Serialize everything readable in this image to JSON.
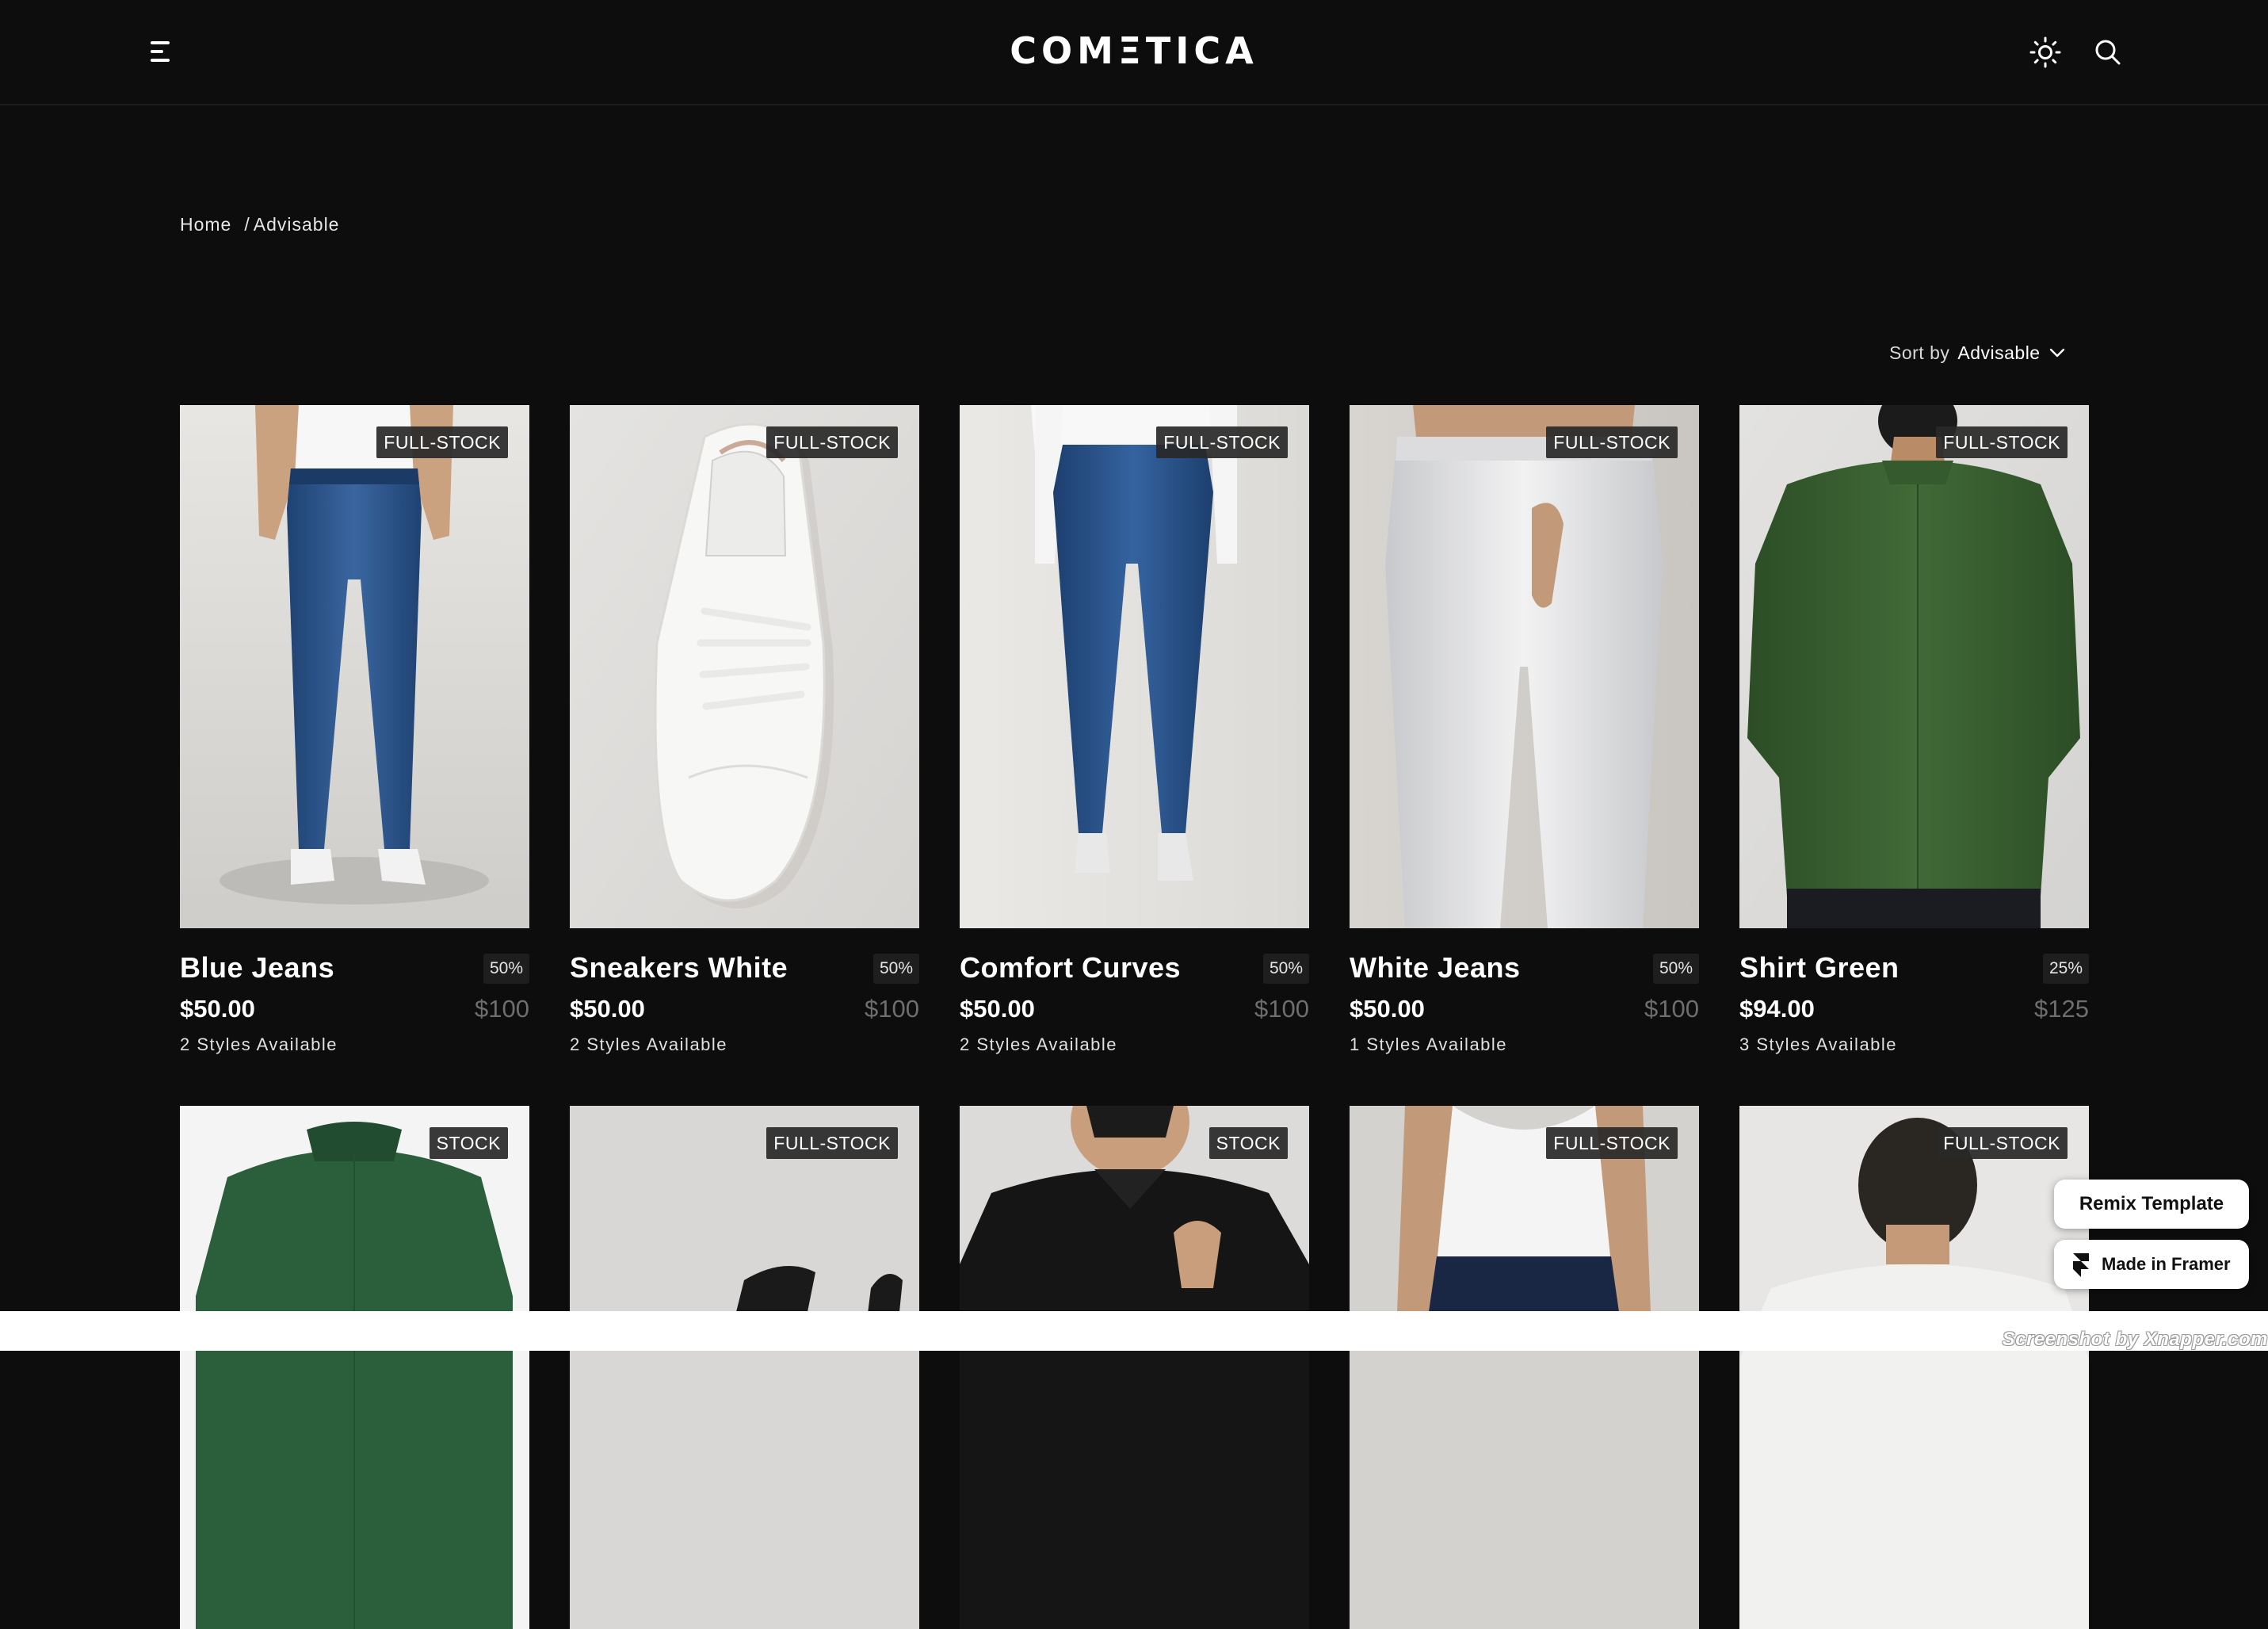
{
  "header": {
    "logo": "COMΞTICA",
    "menu_icon": "hamburger-menu-icon",
    "theme_icon": "sun-icon",
    "search_icon": "search-icon"
  },
  "breadcrumb": {
    "home": "Home",
    "separator": "/",
    "current": "Advisable"
  },
  "sort": {
    "label": "Sort by",
    "value": "Advisable",
    "icon": "chevron-down-icon"
  },
  "products": [
    {
      "name": "Blue Jeans",
      "badge": "FULL-STOCK",
      "discount": "50%",
      "price": "$50.00",
      "old_price": "$100",
      "styles": "2 Styles Available"
    },
    {
      "name": "Sneakers White",
      "badge": "FULL-STOCK",
      "discount": "50%",
      "price": "$50.00",
      "old_price": "$100",
      "styles": "2 Styles Available"
    },
    {
      "name": "Comfort Curves",
      "badge": "FULL-STOCK",
      "discount": "50%",
      "price": "$50.00",
      "old_price": "$100",
      "styles": "2 Styles Available"
    },
    {
      "name": "White Jeans",
      "badge": "FULL-STOCK",
      "discount": "50%",
      "price": "$50.00",
      "old_price": "$100",
      "styles": "1 Styles Available"
    },
    {
      "name": "Shirt Green",
      "badge": "FULL-STOCK",
      "discount": "25%",
      "price": "$94.00",
      "old_price": "$125",
      "styles": "3 Styles Available"
    },
    {
      "badge": "STOCK"
    },
    {
      "badge": "FULL-STOCK"
    },
    {
      "badge": "STOCK"
    },
    {
      "badge": "FULL-STOCK"
    },
    {
      "badge": "FULL-STOCK"
    }
  ],
  "framer": {
    "remix": "Remix Template",
    "made_in": "Made in Framer",
    "framer_icon": "framer-logo-icon"
  },
  "watermark": "Screenshot by Xnapper.com",
  "colors": {
    "background": "#0d0d0d",
    "text": "#ffffff",
    "muted": "#6e6e6e",
    "badge_bg": "#282828"
  }
}
